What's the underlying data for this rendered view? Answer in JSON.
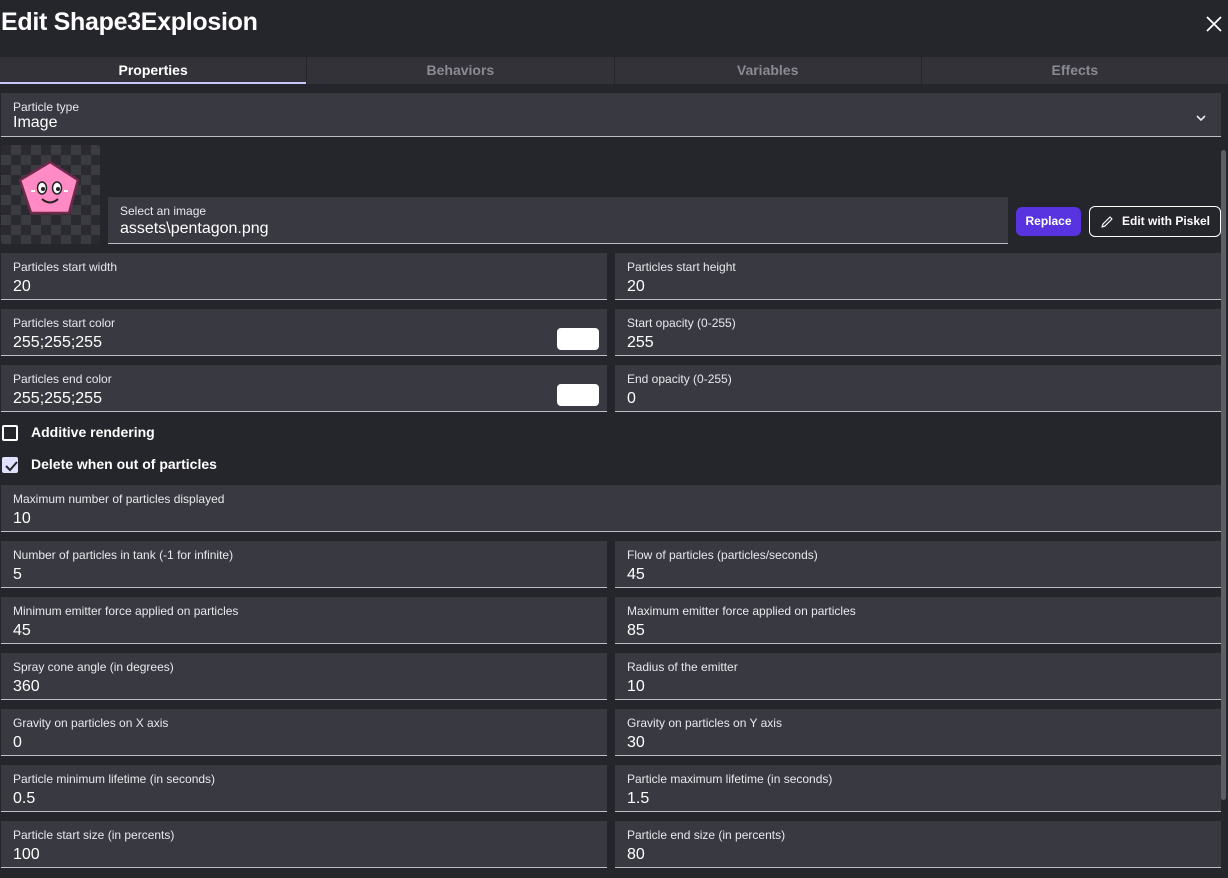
{
  "window": {
    "title": "Edit Shape3Explosion"
  },
  "tabs": [
    {
      "label": "Properties",
      "active": true
    },
    {
      "label": "Behaviors",
      "active": false
    },
    {
      "label": "Variables",
      "active": false
    },
    {
      "label": "Effects",
      "active": false
    }
  ],
  "particle_type": {
    "label": "Particle type",
    "value": "Image"
  },
  "image": {
    "label": "Select an image",
    "value": "assets\\pentagon.png",
    "replace_label": "Replace",
    "edit_label": "Edit with Piskel"
  },
  "fields": {
    "start_width": {
      "label": "Particles start width",
      "value": "20"
    },
    "start_height": {
      "label": "Particles start height",
      "value": "20"
    },
    "start_color": {
      "label": "Particles start color",
      "value": "255;255;255",
      "swatch": "#ffffff"
    },
    "start_opacity": {
      "label": "Start opacity (0-255)",
      "value": "255"
    },
    "end_color": {
      "label": "Particles end color",
      "value": "255;255;255",
      "swatch": "#ffffff"
    },
    "end_opacity": {
      "label": "End opacity (0-255)",
      "value": "0"
    },
    "max_particles": {
      "label": "Maximum number of particles displayed",
      "value": "10"
    },
    "tank": {
      "label": "Number of particles in tank (-1 for infinite)",
      "value": "5"
    },
    "flow": {
      "label": "Flow of particles (particles/seconds)",
      "value": "45"
    },
    "min_force": {
      "label": "Minimum emitter force applied on particles",
      "value": "45"
    },
    "max_force": {
      "label": "Maximum emitter force applied on particles",
      "value": "85"
    },
    "cone": {
      "label": "Spray cone angle (in degrees)",
      "value": "360"
    },
    "radius": {
      "label": "Radius of the emitter",
      "value": "10"
    },
    "gravity_x": {
      "label": "Gravity on particles on X axis",
      "value": "0"
    },
    "gravity_y": {
      "label": "Gravity on particles on Y axis",
      "value": "30"
    },
    "min_life": {
      "label": "Particle minimum lifetime (in seconds)",
      "value": "0.5"
    },
    "max_life": {
      "label": "Particle maximum lifetime (in seconds)",
      "value": "1.5"
    },
    "start_size": {
      "label": "Particle start size (in percents)",
      "value": "100"
    },
    "end_size": {
      "label": "Particle end size (in percents)",
      "value": "80"
    }
  },
  "checkboxes": {
    "additive": {
      "label": "Additive rendering",
      "checked": false
    },
    "delete": {
      "label": "Delete when out of particles",
      "checked": true
    }
  },
  "colors": {
    "accent": "#5734e0",
    "background": "#25252c",
    "field": "#393941"
  }
}
